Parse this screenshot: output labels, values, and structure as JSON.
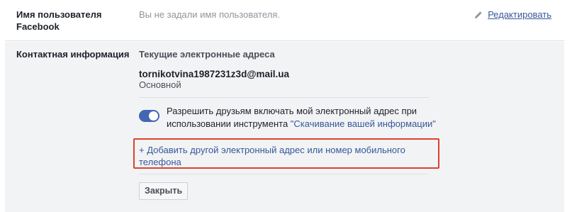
{
  "username_row": {
    "label": "Имя пользователя Facebook",
    "value_placeholder": "Вы не задали имя пользователя.",
    "edit_label": "Редактировать"
  },
  "contact_row": {
    "label": "Контактная информация",
    "section_title": "Текущие электронные адреса",
    "email": "tornikotvina1987231z3d@mail.ua",
    "email_status": "Основной",
    "permission_text": "Разрешить друзьям включать мой электронный адрес при использовании инструмента ",
    "permission_link": "\"Скачивание вашей информации\"",
    "permission_enabled": true,
    "add_link": "+ Добавить другой электронный адрес или номер мобильного телефона",
    "close_label": "Закрыть"
  },
  "colors": {
    "link": "#365899",
    "toggle_on": "#4267b2",
    "highlight_box": "#d9432e",
    "section_bg": "#f2f3f5"
  }
}
